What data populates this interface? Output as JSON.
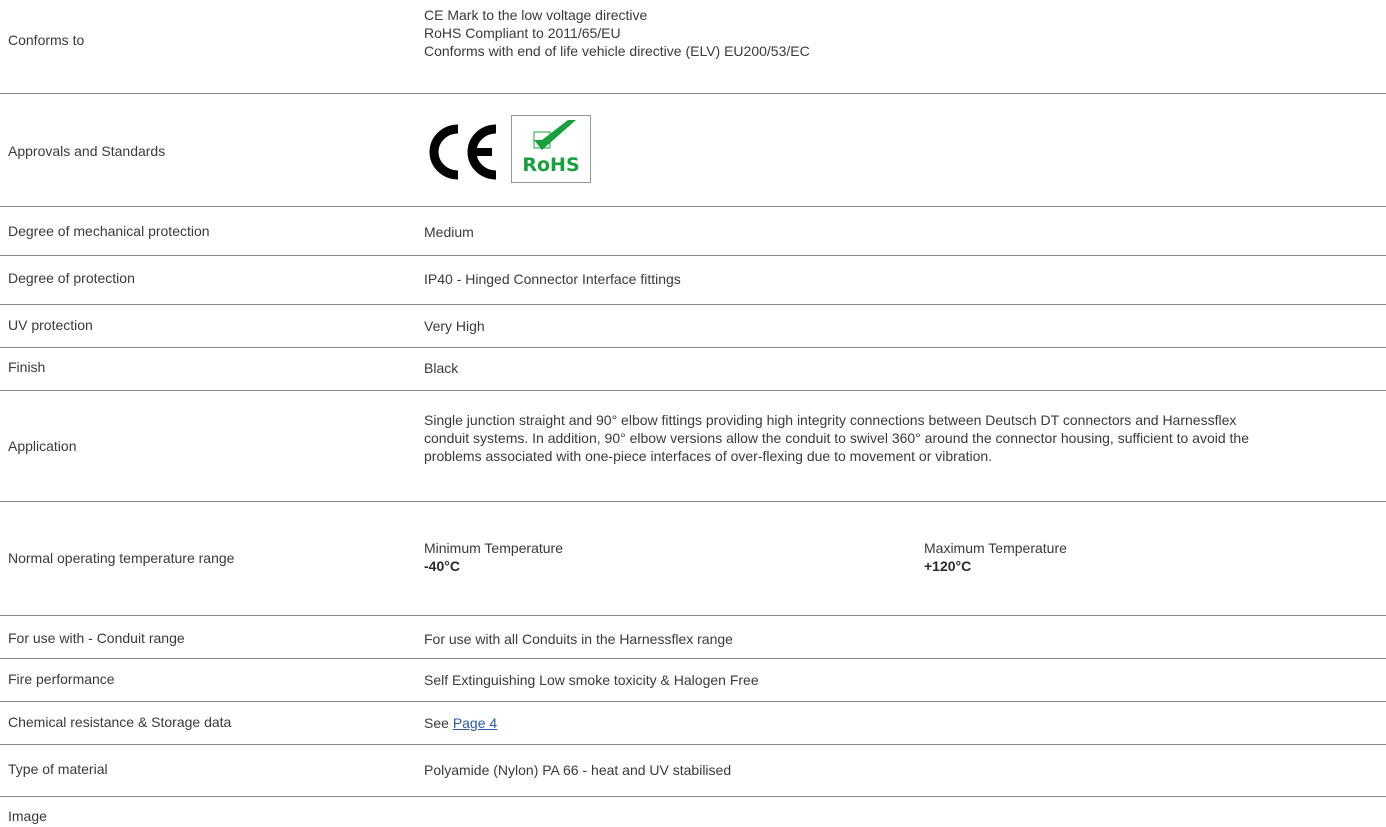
{
  "rows": {
    "conforms": {
      "label": "Conforms to",
      "lines": [
        "CE Mark to the low voltage directive",
        "RoHS Compliant to 2011/65/EU",
        "Conforms with end of life vehicle directive (ELV) EU200/53/EC"
      ]
    },
    "approvals": {
      "label": "Approvals and Standards",
      "logos": [
        "ce-mark",
        "rohs-logo"
      ],
      "rohs_text": "RoHS"
    },
    "mechanical": {
      "label": "Degree of mechanical protection",
      "value": "Medium"
    },
    "protection": {
      "label": "Degree of protection",
      "value": "IP40 - Hinged Connector Interface fittings"
    },
    "uv": {
      "label": "UV protection",
      "value": "Very High"
    },
    "finish": {
      "label": "Finish",
      "value": "Black"
    },
    "application": {
      "label": "Application",
      "lines": [
        "Single junction straight and 90° elbow fittings providing high integrity  connections between Deutsch DT connectors and Harnessflex",
        "conduit  systems. In addition, 90° elbow versions allow the conduit to swivel 360° around the connector housing, sufficient to avoid the",
        "problems associated with one-piece interfaces of over-flexing due to movement or vibration."
      ]
    },
    "temperature": {
      "label": "Normal operating temperature range",
      "min_label": "Minimum Temperature",
      "min_value": "-40°C",
      "max_label": "Maximum Temperature",
      "max_value": "+120°C"
    },
    "conduit": {
      "label": "For use with - Conduit range",
      "value": "For use with all Conduits in the Harnessflex range"
    },
    "fire": {
      "label": "Fire performance",
      "value": "Self Extinguishing Low smoke toxicity & Halogen Free"
    },
    "chemical": {
      "label": "Chemical resistance & Storage data",
      "prefix": "See",
      "link_text": "Page 4"
    },
    "material": {
      "label": "Type of material",
      "value": "Polyamide (Nylon) PA 66 - heat and UV stabilised"
    },
    "image": {
      "label": "Image"
    }
  },
  "colors": {
    "text": "#3a3a3a",
    "divider": "#8a8a8a",
    "link": "#2a5aa8",
    "rohs_green": "#18a03c"
  }
}
